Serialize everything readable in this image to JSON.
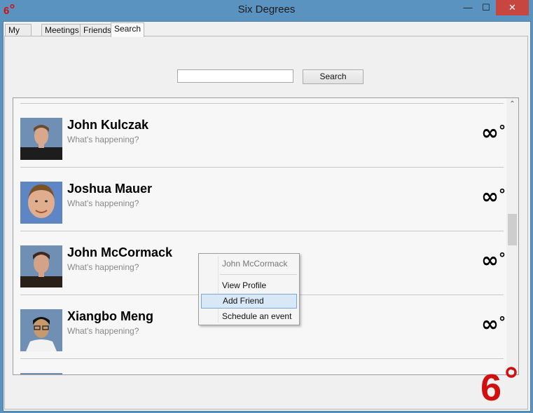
{
  "window": {
    "title": "Six Degrees",
    "minimize": "—",
    "maximize": "☐",
    "close": "✕"
  },
  "tabs": [
    {
      "label": "My Page"
    },
    {
      "label": "Meetings"
    },
    {
      "label": "Friends"
    },
    {
      "label": "Search"
    }
  ],
  "search": {
    "value": "",
    "button_label": "Search"
  },
  "results": [
    {
      "name": "John Kulczak",
      "status": "What's happening?",
      "degree": "∞",
      "degree_symbol": "°"
    },
    {
      "name": "Joshua Mauer",
      "status": "What's happening?",
      "degree": "∞",
      "degree_symbol": "°"
    },
    {
      "name": "John McCormack",
      "status": "What's happening?",
      "degree": "∞",
      "degree_symbol": "°"
    },
    {
      "name": "Xiangbo Meng",
      "status": "What's happening?",
      "degree": "∞",
      "degree_symbol": "°"
    }
  ],
  "context_menu": {
    "header": "John McCormack",
    "items": [
      "View Profile",
      "Add Friend",
      "Schedule an event"
    ]
  },
  "colors": {
    "titlebar": "#5a93c0",
    "close": "#c7463f",
    "brand_red": "#d01010",
    "menu_highlight": "#d9e8f7"
  }
}
